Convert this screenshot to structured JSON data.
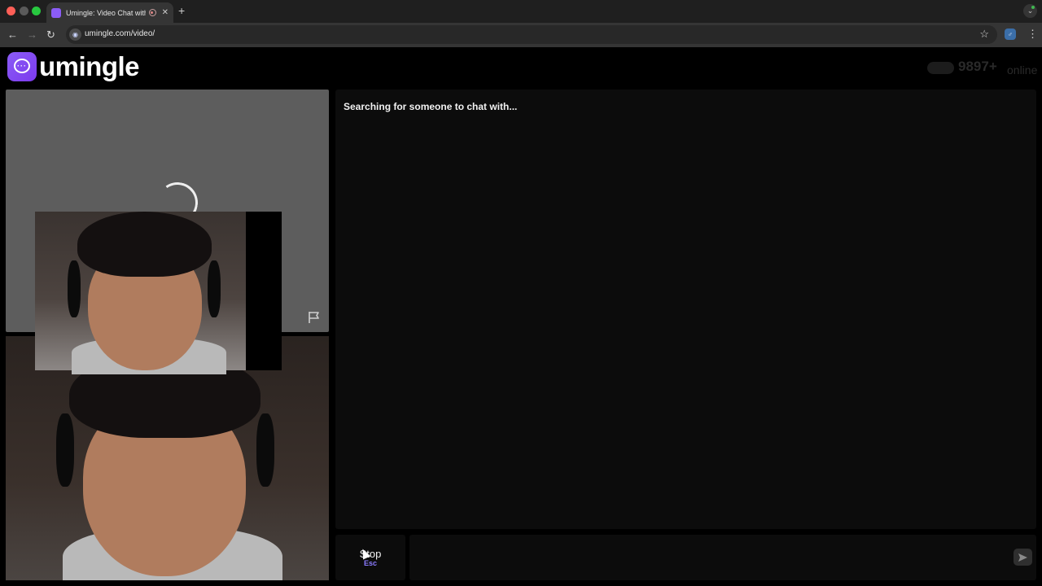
{
  "browser": {
    "tab_title": "Umingle: Video Chat with",
    "tab_close": "✕",
    "new_tab": "+",
    "url": "umingle.com/video/",
    "back_icon": "arrow-left-icon",
    "forward_icon": "arrow-right-icon",
    "reload_icon": "reload-icon",
    "bookmark_icon": "star-icon"
  },
  "header": {
    "logo_text": "umingle",
    "online_count": "9897+",
    "online_label": "online"
  },
  "stranger": {
    "report_icon": "flag-icon"
  },
  "chat": {
    "status": "Searching for someone to chat with...",
    "input_value": "",
    "send_icon": "send-icon"
  },
  "controls": {
    "stop_label": "Stop",
    "stop_hint": "Esc"
  },
  "colors": {
    "brand": "#8b5cf6",
    "hint": "#8b7bff",
    "panel": "#0c0c0c"
  }
}
